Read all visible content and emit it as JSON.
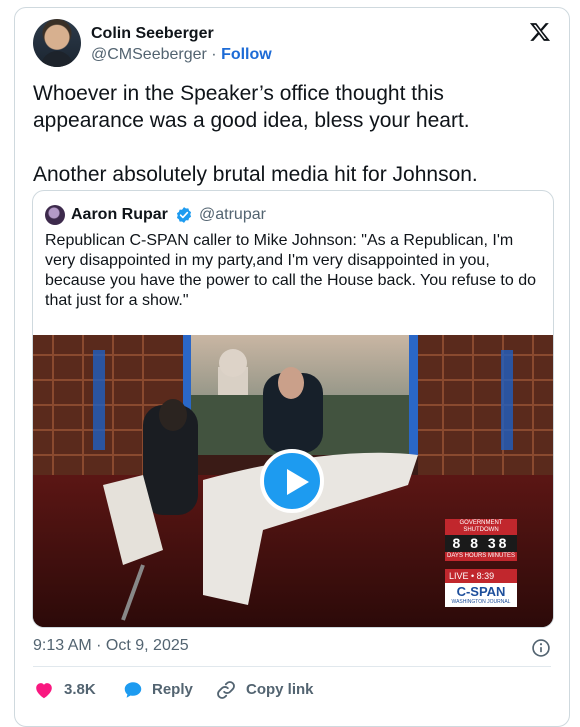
{
  "author": {
    "name": "Colin Seeberger",
    "handle": "@CMSeeberger",
    "separator": " · ",
    "follow_label": "Follow"
  },
  "tweet": {
    "paragraphs": [
      "Whoever in the Speaker’s office thought this appearance was a good idea, bless your heart.",
      "Another absolutely brutal media hit for Johnson."
    ],
    "timestamp": "9:13 AM · Oct 9, 2025"
  },
  "quote": {
    "name": "Aaron Rupar",
    "handle": "@atrupar",
    "text": "Republican C-SPAN caller to Mike Johnson: \"As a Republican, I'm very disappointed in my party,and I'm very disappointed in you, because you have the power to call the House back. You refuse to do that just for a show.\"",
    "video_overlay": {
      "banner": "GOVERNMENT SHUTDOWN",
      "count": "8 8 38",
      "count_units": "DAYS HOURS MINUTES",
      "live": "LIVE • 8:39",
      "logo": "C-SPAN",
      "logo_sub": "WASHINGTON JOURNAL"
    }
  },
  "actions": {
    "like_count": "3.8K",
    "reply_label": "Reply",
    "copy_label": "Copy link"
  },
  "colors": {
    "like": "#f91880",
    "reply": "#1d9bf0",
    "accent": "#1d6bd6",
    "play": "#1d9bf0"
  }
}
